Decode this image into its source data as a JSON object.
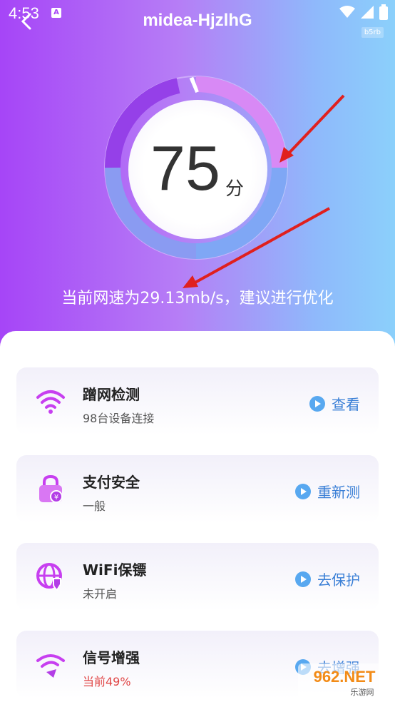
{
  "status_bar": {
    "time": "4:53",
    "notification_letter": "A"
  },
  "header": {
    "title": "midea-HjzlhG",
    "badge": "b5rb"
  },
  "score": {
    "value": "75",
    "unit": "分",
    "level": 0.75
  },
  "speed_message": "当前网速为29.13mb/s，建议进行优化",
  "cards": [
    {
      "title": "蹭网检测",
      "subtitle": "98台设备连接",
      "action": "查看",
      "icon": "wifi-icon"
    },
    {
      "title": "支付安全",
      "subtitle": "一般",
      "action": "重新测",
      "icon": "lock-yen-icon"
    },
    {
      "title": "WiFi保镖",
      "subtitle": "未开启",
      "action": "去保护",
      "icon": "globe-shield-icon"
    },
    {
      "title": "信号增强",
      "subtitle": "当前49%",
      "action": "去增强",
      "icon": "signal-boost-icon"
    }
  ],
  "watermark": {
    "text": "962.NET",
    "sub": "乐游网"
  },
  "colors": {
    "accent": "#3a7fd6",
    "warn": "#e04545",
    "purple": "#a645f7"
  }
}
